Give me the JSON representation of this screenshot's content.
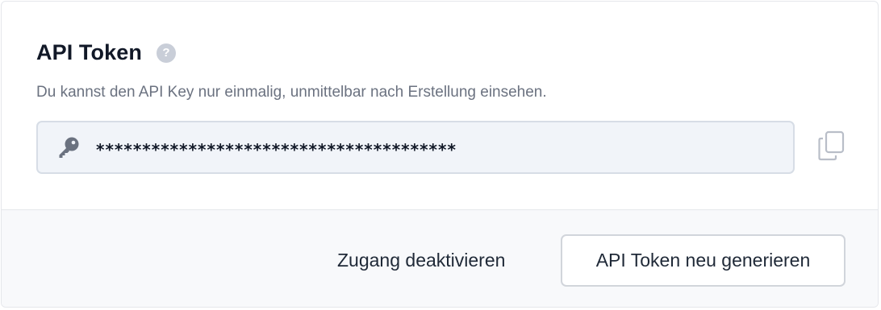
{
  "header": {
    "title": "API Token",
    "help_icon": "question-icon",
    "help_symbol": "?"
  },
  "description": "Du kannst den API Key nur einmalig, unmittelbar nach Erstellung einsehen.",
  "token": {
    "icon": "key-icon",
    "value": "***************************************"
  },
  "copy": {
    "icon": "copy-icon"
  },
  "footer": {
    "deactivate_label": "Zugang deaktivieren",
    "regenerate_label": "API Token neu generieren"
  },
  "colors": {
    "title": "#111827",
    "muted_text": "#6b7280",
    "field_bg": "#f1f4f9",
    "footer_bg": "#f8f9fb",
    "icon_gray": "#6b7280"
  }
}
